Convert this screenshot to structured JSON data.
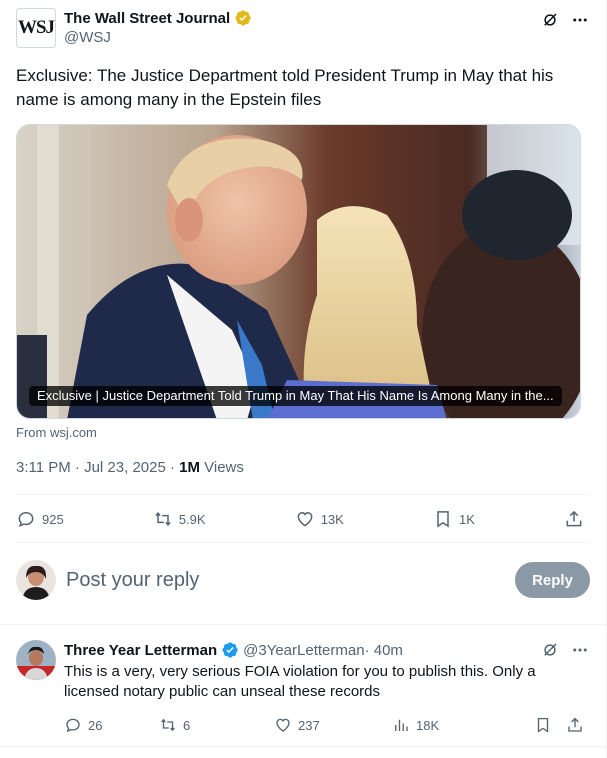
{
  "tweet": {
    "author_name": "The Wall Street Journal",
    "author_handle": "@WSJ",
    "logo_text": "WSJ",
    "text": "Exclusive: The Justice Department told President Trump in May that his name is among many in the Epstein files",
    "card_caption": "Exclusive | Justice Department Told Trump in May That His Name Is Among Many in the...",
    "card_source": "From wsj.com",
    "time": "3:11 PM · Jul 23, 2025 · ",
    "views_count": "1M",
    "views_label": " Views"
  },
  "actions": {
    "replies": "925",
    "retweets": "5.9K",
    "likes": "13K",
    "bookmarks": "1K"
  },
  "composer": {
    "placeholder": "Post your reply",
    "button_label": "Reply"
  },
  "reply": {
    "name": "Three Year Letterman",
    "handle": "@3YearLetterman",
    "time": " · 40m",
    "text": "This is a very, very serious FOIA violation for you to publish this. Only a licensed notary public can unseal these records",
    "replies": "26",
    "retweets": "6",
    "likes": "237",
    "views": "18K"
  },
  "icons": {
    "verified_gold": "verified-gold-badge-icon",
    "verified_blue": "verified-blue-badge-icon",
    "grok": "grok-icon",
    "more": "more-icon",
    "reply": "reply-icon",
    "retweet": "retweet-icon",
    "like": "heart-icon",
    "bookmark": "bookmark-icon",
    "share": "share-icon",
    "views": "views-icon"
  },
  "colors": {
    "text": "#0f1419",
    "muted": "#536471",
    "reply_button": "#8b98a5",
    "verified_gold": "#e2b719",
    "verified_blue": "#1d9bf0"
  }
}
